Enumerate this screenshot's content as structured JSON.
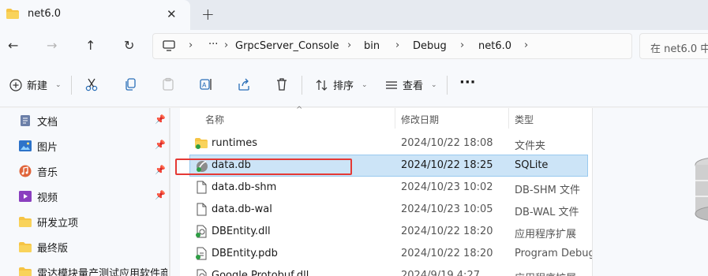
{
  "tab": {
    "title": "net6.0",
    "close": "✕",
    "new_tab": "+"
  },
  "nav": {
    "back": "←",
    "forward": "→",
    "up": "↑",
    "refresh": "↻"
  },
  "breadcrumb": {
    "more": "···",
    "items": [
      "GrpcServer_Console",
      "bin",
      "Debug",
      "net6.0"
    ],
    "sep": "›"
  },
  "search": {
    "placeholder": "在 net6.0 中"
  },
  "toolbar": {
    "new_label": "新建",
    "sort_label": "排序",
    "view_label": "查看",
    "more": "···"
  },
  "sidebar": {
    "items": [
      {
        "label": "文档",
        "icon": "documents-icon",
        "pinned": true
      },
      {
        "label": "图片",
        "icon": "pictures-icon",
        "pinned": true
      },
      {
        "label": "音乐",
        "icon": "music-icon",
        "pinned": true
      },
      {
        "label": "视频",
        "icon": "videos-icon",
        "pinned": true
      },
      {
        "label": "研发立项",
        "icon": "folder-icon",
        "pinned": false
      },
      {
        "label": "最终版",
        "icon": "folder-icon",
        "pinned": false
      },
      {
        "label": "雷达模块量产测试应用软件商用",
        "icon": "folder-icon",
        "pinned": false
      }
    ]
  },
  "columns": {
    "name": "名称",
    "modified": "修改日期",
    "type": "类型"
  },
  "files": [
    {
      "name": "runtimes",
      "modified": "2024/10/22 18:08",
      "type": "文件夹",
      "icon": "folder-icon"
    },
    {
      "name": "data.db",
      "modified": "2024/10/22 18:25",
      "type": "SQLite",
      "icon": "sqlite-file-icon"
    },
    {
      "name": "data.db-shm",
      "modified": "2024/10/23 10:02",
      "type": "DB-SHM 文件",
      "icon": "file-icon"
    },
    {
      "name": "data.db-wal",
      "modified": "2024/10/23 10:05",
      "type": "DB-WAL 文件",
      "icon": "file-icon"
    },
    {
      "name": "DBEntity.dll",
      "modified": "2024/10/22 18:20",
      "type": "应用程序扩展",
      "icon": "dll-file-icon"
    },
    {
      "name": "DBEntity.pdb",
      "modified": "2024/10/22 18:20",
      "type": "Program Debug",
      "icon": "pdb-file-icon"
    },
    {
      "name": "Google.Protobuf.dll",
      "modified": "2024/9/19 4:27",
      "type": "应用程序扩展",
      "icon": "dll-file-icon"
    }
  ],
  "colors": {
    "selection": "#cce4f7",
    "highlight_box": "#e53935",
    "folder": "#f6c445"
  }
}
